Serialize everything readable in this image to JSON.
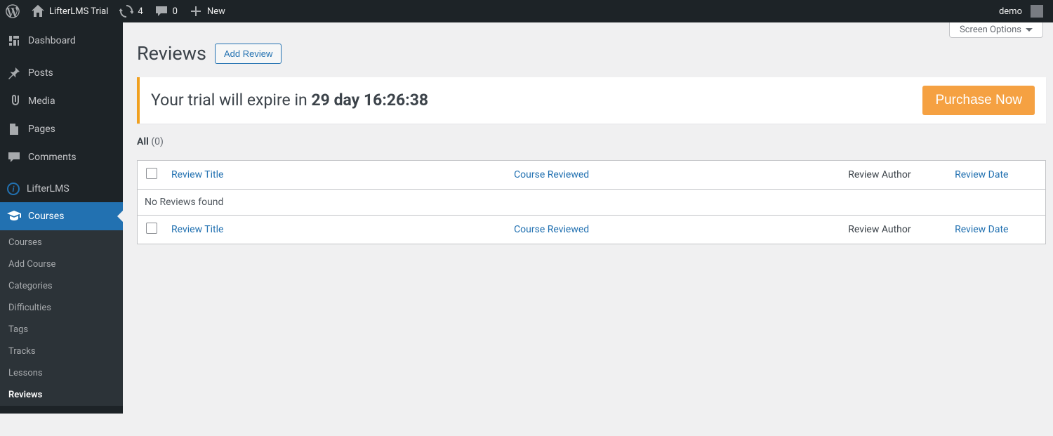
{
  "adminbar": {
    "site_name": "LifterLMS Trial",
    "updates_count": "4",
    "comments_count": "0",
    "new_label": "New",
    "user_display": "demo"
  },
  "sidebar": {
    "items": [
      {
        "label": "Dashboard"
      },
      {
        "label": "Posts"
      },
      {
        "label": "Media"
      },
      {
        "label": "Pages"
      },
      {
        "label": "Comments"
      },
      {
        "label": "LifterLMS"
      },
      {
        "label": "Courses"
      }
    ],
    "submenu": [
      {
        "label": "Courses"
      },
      {
        "label": "Add Course"
      },
      {
        "label": "Categories"
      },
      {
        "label": "Difficulties"
      },
      {
        "label": "Tags"
      },
      {
        "label": "Tracks"
      },
      {
        "label": "Lessons"
      },
      {
        "label": "Reviews"
      }
    ]
  },
  "screen_options_label": "Screen Options",
  "page": {
    "title": "Reviews",
    "add_button": "Add Review"
  },
  "trial": {
    "prefix": "Your trial will expire in ",
    "countdown": "29 day 16:26:38",
    "purchase_label": "Purchase Now"
  },
  "filter": {
    "label": "All",
    "count": "(0)"
  },
  "table": {
    "columns": {
      "title": "Review Title",
      "course": "Course Reviewed",
      "author": "Review Author",
      "date": "Review Date"
    },
    "empty_message": "No Reviews found"
  }
}
